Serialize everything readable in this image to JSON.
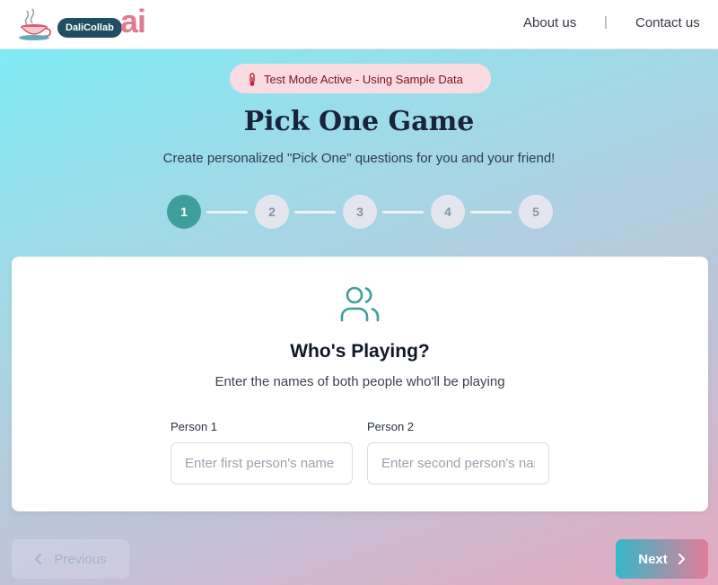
{
  "header": {
    "logo_text": "DaliCollab",
    "logo_suffix": "ai",
    "nav": [
      {
        "label": "About us"
      },
      {
        "label": "Contact us"
      }
    ],
    "separator": "|"
  },
  "banner": {
    "icon": "thermometer-icon",
    "text": "Test Mode Active - Using Sample Data"
  },
  "page": {
    "title": "Pick One Game",
    "subtitle": "Create personalized \"Pick One\" questions for you and your friend!"
  },
  "stepper": {
    "current": 1,
    "steps": [
      "1",
      "2",
      "3",
      "4",
      "5"
    ]
  },
  "card": {
    "icon": "users-icon",
    "title": "Who's Playing?",
    "description": "Enter the names of both people who'll be playing",
    "fields": [
      {
        "label": "Person 1",
        "value": "",
        "placeholder": "Enter first person's name"
      },
      {
        "label": "Person 2",
        "value": "",
        "placeholder": "Enter second person's name"
      }
    ]
  },
  "buttons": {
    "previous": "Previous",
    "next": "Next"
  },
  "colors": {
    "accent": "#3e9e99",
    "banner_bg": "#fbdbe2",
    "banner_text": "#7a1024",
    "next_gradient_start": "#35b8c8",
    "next_gradient_end": "#e37c99"
  }
}
